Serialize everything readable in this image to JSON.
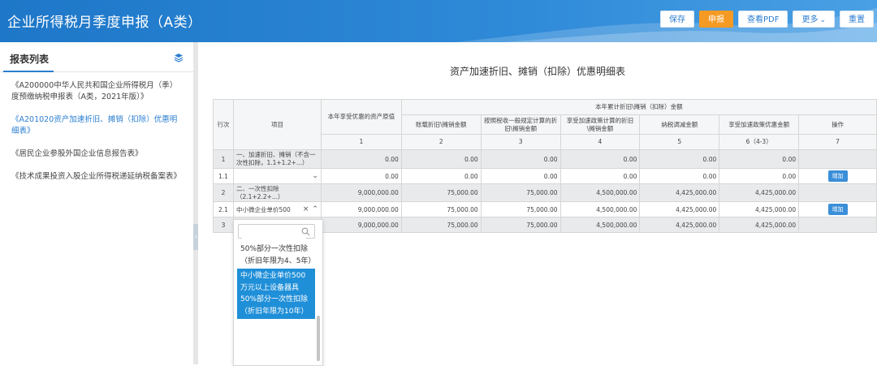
{
  "header": {
    "title": "企业所得税月季度申报（A类）",
    "buttons": {
      "save": "保存",
      "submit": "申报",
      "view_pdf": "查看PDF",
      "more": "更多",
      "reset": "重置"
    }
  },
  "sidebar": {
    "title": "报表列表",
    "items": [
      "《A200000中华人民共和国企业所得税月（季）度预缴纳税申报表（A类，2021年版）》",
      "《A201020资产加速折旧、摊销（扣除）优惠明细表》",
      "《居民企业参股外国企业信息报告表》",
      "《技术成果投资入股企业所得税递延纳税备案表》"
    ]
  },
  "main": {
    "table_title": "资产加速折旧、摊销（扣除）优惠明细表",
    "headers": {
      "row_no": "行次",
      "item": "项目",
      "original_value": "本年享受优惠的资产原值",
      "group": "本年累计折旧\\摊销（扣除）金额",
      "book": "账载折旧\\摊销金额",
      "general": "按照税收一般规定计算的折旧\\摊销金额",
      "accelerated": "享受加速政策计算的折旧\\摊销金额",
      "tax_adjust": "纳税调减金额",
      "benefit": "享受加速政策优惠金额",
      "op": "操作"
    },
    "col_numbers": [
      "1",
      "2",
      "3",
      "4",
      "5",
      "6（4-3）",
      "7"
    ],
    "rows": [
      {
        "no": "1",
        "item": "一、加速折旧、摊销（不含一次性扣除，1.1+1.2+...）",
        "values": [
          "0.00",
          "0.00",
          "0.00",
          "0.00",
          "0.00",
          "0.00"
        ],
        "action": ""
      },
      {
        "no": "1.1",
        "item": "",
        "values": [
          "0.00",
          "0.00",
          "0.00",
          "0.00",
          "0.00",
          "0.00"
        ],
        "action": "增加"
      },
      {
        "no": "2",
        "item": "二、一次性扣除（2.1+2.2+...）",
        "values": [
          "9,000,000.00",
          "75,000.00",
          "75,000.00",
          "4,500,000.00",
          "4,425,000.00",
          "4,425,000.00"
        ],
        "action": ""
      },
      {
        "no": "2.1",
        "item": "中小微企业单价500",
        "values": [
          "9,000,000.00",
          "75,000.00",
          "75,000.00",
          "4,500,000.00",
          "4,425,000.00",
          "4,425,000.00"
        ],
        "action": "增加"
      },
      {
        "no": "3",
        "item": "",
        "values": [
          "9,000,000.00",
          "75,000.00",
          "75,000.00",
          "4,500,000.00",
          "4,425,000.00",
          "4,425,000.00"
        ],
        "action": ""
      }
    ]
  },
  "dropdown": {
    "search_placeholder": "",
    "options": [
      "50%部分一次性扣除（折旧年限为4、5年）",
      "中小微企业单价500万元以上设备器具50%部分一次性扣除（折旧年限为10年）"
    ]
  },
  "colors": {
    "header_blue": "#1e77c8",
    "accent_orange": "#f59a23",
    "link_blue": "#2b7ed0",
    "selected_option": "#1f8fd8"
  },
  "icons": {
    "stack": "stack-icon",
    "search": "search-icon",
    "chevron_down": "chevron-down-icon",
    "chevron_up": "chevron-up-icon",
    "clear": "close-icon",
    "collapse": "chevron-left-icon"
  }
}
